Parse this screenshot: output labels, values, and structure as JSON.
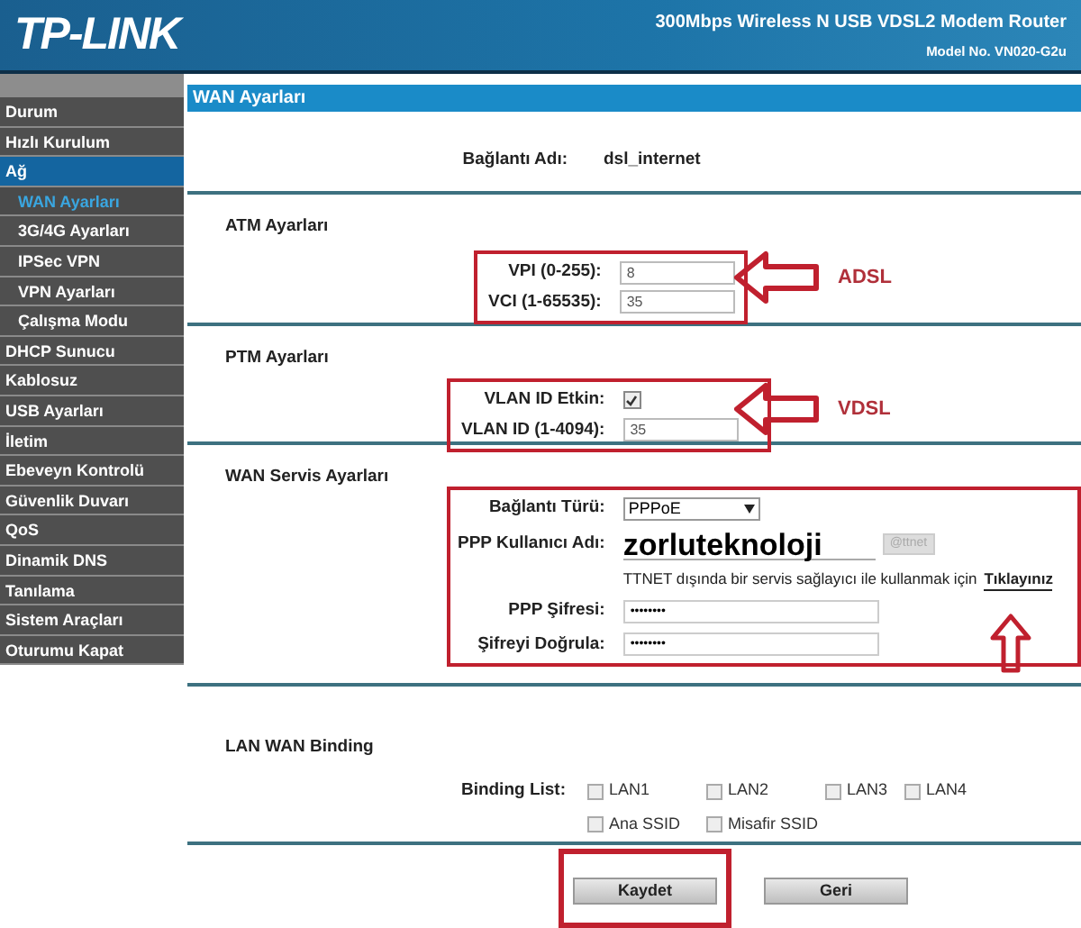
{
  "header": {
    "logo": "TP-LINK",
    "product": "300Mbps Wireless N USB VDSL2 Modem Router",
    "model": "Model No. VN020-G2u"
  },
  "sidebar": {
    "items": [
      {
        "label": "Durum",
        "selected": false
      },
      {
        "label": "Hızlı Kurulum",
        "selected": false
      },
      {
        "label": "Ağ",
        "selected": true,
        "children": [
          {
            "label": "WAN Ayarları",
            "selected": true
          },
          {
            "label": "3G/4G Ayarları",
            "selected": false
          },
          {
            "label": "IPSec VPN",
            "selected": false
          },
          {
            "label": "VPN Ayarları",
            "selected": false
          },
          {
            "label": "Çalışma Modu",
            "selected": false
          }
        ]
      },
      {
        "label": "DHCP Sunucu",
        "selected": false
      },
      {
        "label": "Kablosuz",
        "selected": false
      },
      {
        "label": "USB Ayarları",
        "selected": false
      },
      {
        "label": "İletim",
        "selected": false
      },
      {
        "label": "Ebeveyn Kontrolü",
        "selected": false
      },
      {
        "label": "Güvenlik Duvarı",
        "selected": false
      },
      {
        "label": "QoS",
        "selected": false
      },
      {
        "label": "Dinamik DNS",
        "selected": false
      },
      {
        "label": "Tanılama",
        "selected": false
      },
      {
        "label": "Sistem Araçları",
        "selected": false
      },
      {
        "label": "Oturumu Kapat",
        "selected": false
      }
    ]
  },
  "page_title": "WAN Ayarları",
  "connection": {
    "label": "Bağlantı Adı:",
    "value": "dsl_internet"
  },
  "sections": [
    {
      "kind": "atm",
      "title": "ATM Ayarları",
      "highlighted": true,
      "callout": "ADSL",
      "rows": [
        {
          "kind": "text",
          "label": "VPI (0-255):",
          "value": "8"
        },
        {
          "kind": "text",
          "label": "VCI (1-65535):",
          "value": "35"
        }
      ]
    },
    {
      "kind": "ptm",
      "title": "PTM Ayarları",
      "highlighted": true,
      "callout": "VDSL",
      "rows": [
        {
          "kind": "checkbox",
          "label": "VLAN ID Etkin:",
          "checked": true
        },
        {
          "kind": "text",
          "label": "VLAN ID (1-4094):",
          "value": "35"
        }
      ]
    },
    {
      "kind": "wan",
      "title": "WAN Servis Ayarları",
      "highlighted": true,
      "link_arrow": true,
      "rows": [
        {
          "kind": "select",
          "label": "Bağlantı Türü:",
          "value": "PPPoE"
        },
        {
          "kind": "user",
          "label": "PPP Kullanıcı Adı:",
          "value": "zorluteknoloji",
          "suffix": {
            "label": "@ttnet",
            "disabled": true
          }
        },
        {
          "kind": "note",
          "text": "TTNET dışında bir servis sağlayıcı ile kullanmak için",
          "link": "Tıklayınız"
        },
        {
          "kind": "password",
          "label": "PPP Şifresi:",
          "value": "••••••••"
        },
        {
          "kind": "password",
          "label": "Şifreyi Doğrula:",
          "value": "••••••••"
        }
      ]
    }
  ],
  "binding": {
    "title": "LAN WAN Binding",
    "label": "Binding List:",
    "options": [
      {
        "label": "LAN1",
        "checked": false
      },
      {
        "label": "LAN2",
        "checked": false
      },
      {
        "label": "LAN3",
        "checked": false
      },
      {
        "label": "LAN4",
        "checked": false
      },
      {
        "label": "Ana SSID",
        "checked": false
      },
      {
        "label": "Misafir SSID",
        "checked": false
      }
    ]
  },
  "buttons": [
    {
      "label": "Kaydet",
      "highlighted": true
    },
    {
      "label": "Geri",
      "highlighted": false
    }
  ]
}
